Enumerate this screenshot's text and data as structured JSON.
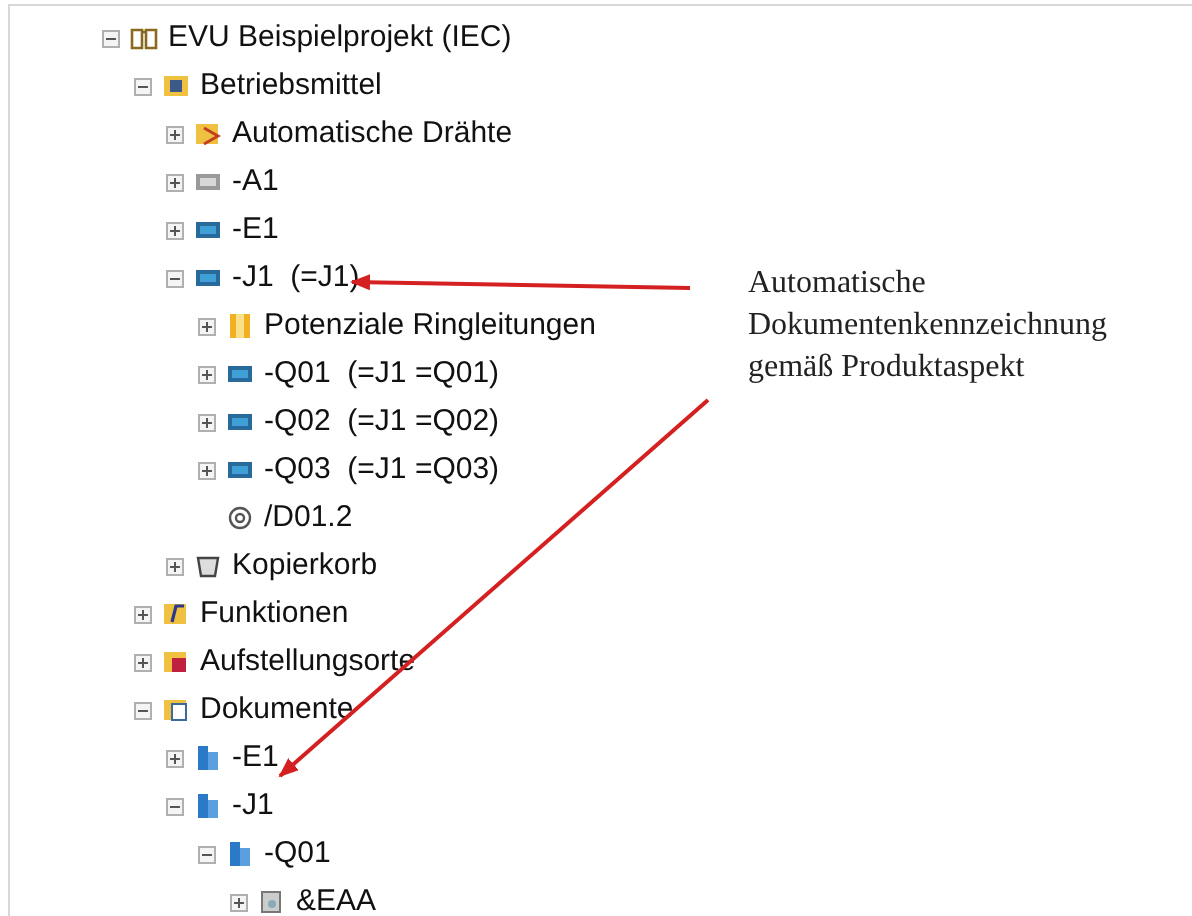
{
  "tree": [
    {
      "label": "EVU Beispielprojekt (IEC)",
      "kind": "project",
      "expanded": true,
      "children": [
        {
          "label": "Betriebsmittel",
          "kind": "equipment",
          "expanded": true,
          "children": [
            {
              "label": "Automatische Drähte",
              "kind": "wires",
              "expanded": false
            },
            {
              "label": "-A1",
              "kind": "device-gray",
              "expanded": false
            },
            {
              "label": "-E1",
              "kind": "device",
              "expanded": false
            },
            {
              "label": "-J1  (=J1)",
              "kind": "device",
              "expanded": true,
              "children": [
                {
                  "label": "Potenziale Ringleitungen",
                  "kind": "folder",
                  "expanded": false
                },
                {
                  "label": "-Q01  (=J1 =Q01)",
                  "kind": "device",
                  "expanded": false
                },
                {
                  "label": "-Q02  (=J1 =Q02)",
                  "kind": "device",
                  "expanded": false
                },
                {
                  "label": "-Q03  (=J1 =Q03)",
                  "kind": "device",
                  "expanded": false
                },
                {
                  "label": "/D01.2",
                  "kind": "view"
                }
              ]
            },
            {
              "label": "Kopierkorb",
              "kind": "basket",
              "expanded": false
            }
          ]
        },
        {
          "label": "Funktionen",
          "kind": "functions",
          "expanded": false
        },
        {
          "label": "Aufstellungsorte",
          "kind": "locations",
          "expanded": false
        },
        {
          "label": "Dokumente",
          "kind": "documents",
          "expanded": true,
          "children": [
            {
              "label": "-E1",
              "kind": "doc",
              "expanded": false
            },
            {
              "label": "-J1",
              "kind": "doc",
              "expanded": true,
              "children": [
                {
                  "label": "-Q01",
                  "kind": "doc",
                  "expanded": true,
                  "children": [
                    {
                      "label": "&EAA",
                      "kind": "doc-gray",
                      "expanded": false
                    }
                  ]
                }
              ]
            }
          ]
        }
      ]
    }
  ],
  "annotation": {
    "lines": [
      "Automatische",
      "Dokumentenkennzeichnung",
      "gemäß Produktaspekt"
    ]
  }
}
